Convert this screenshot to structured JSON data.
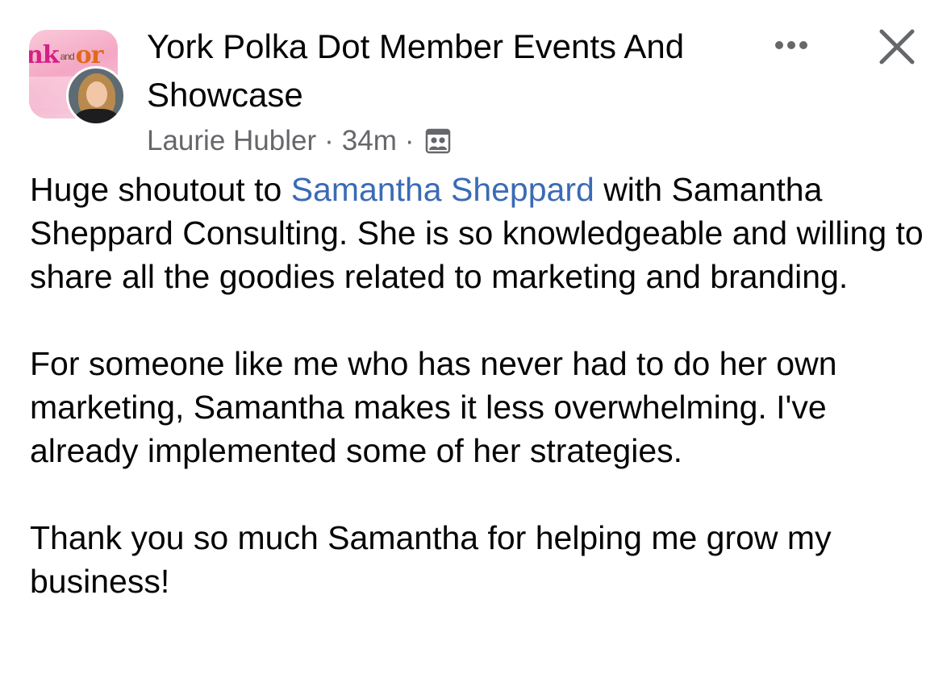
{
  "post": {
    "group_name": "York Polka Dot Member Events And Showcase",
    "group_avatar_icon": "group-avatar-logo",
    "group_logo_text": [
      "nk",
      "and",
      "or"
    ],
    "author": "Laurie Hubler",
    "separator": "·",
    "time": "34m",
    "audience_icon": "group-members-icon",
    "paragraphs": [
      {
        "before": "Huge shoutout to ",
        "mention": "Samantha Sheppard",
        "after": " with Samantha Sheppard Consulting. She is so knowledgeable and willing to share all the goodies related to marketing and branding."
      },
      {
        "text": "For someone like me who has never had to do her own marketing, Samantha makes it less overwhelming. I've already implemented some of her strategies."
      },
      {
        "text": "Thank you so much Samantha for helping me grow my business!"
      }
    ]
  },
  "controls": {
    "more_icon": "more-horizontal-icon",
    "close_icon": "close-icon"
  },
  "colors": {
    "text": "#050505",
    "secondary_text": "#65676b",
    "mention_link": "#3a6bb5",
    "background": "#ffffff"
  }
}
